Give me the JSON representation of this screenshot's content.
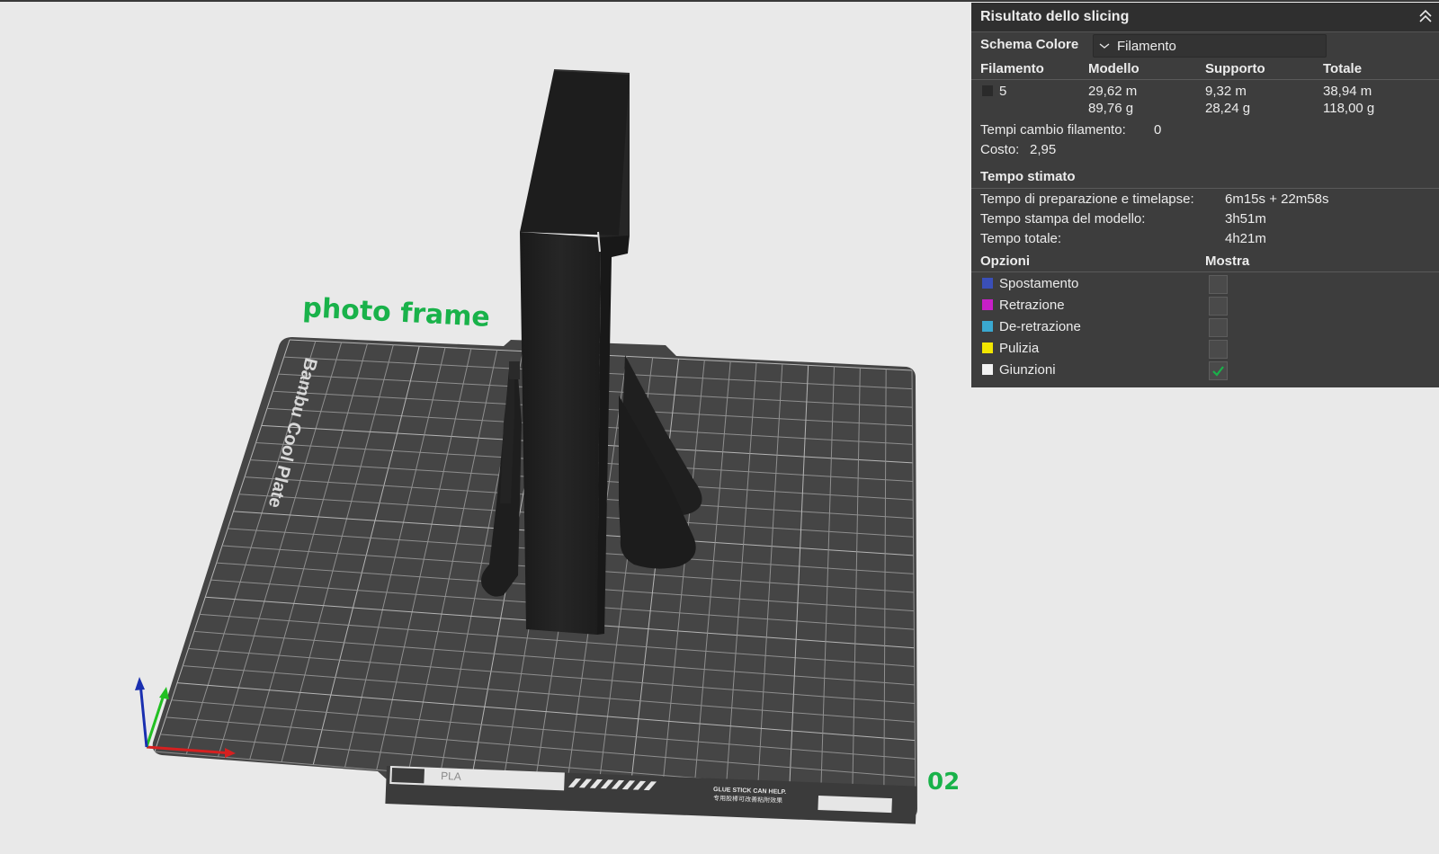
{
  "scene": {
    "plate_label": "Bambu Cool Plate",
    "object_label": "photo frame",
    "plate_number": "02",
    "plate_strip_text": "PLA",
    "plate_glue_text": "GLUE STICK CAN HELP.",
    "plate_glue_text_2": "专用胶棒可改善粘附效果",
    "colors": {
      "background": "#e9e9e9",
      "plate": "#454545",
      "grid": "#8f8f8f",
      "model": "#202020",
      "label_green": "#19b24a",
      "axis_x": "#d62020",
      "axis_y": "#22c022",
      "axis_z": "#1a2fb0"
    }
  },
  "panel": {
    "title": "Risultato dello slicing",
    "color_scheme_label": "Schema Colore",
    "color_scheme_value": "Filamento",
    "columns": [
      "Filamento",
      "Modello",
      "Supporto",
      "Totale"
    ],
    "filament": {
      "id": "5",
      "swatch_color": "#2a2a2a",
      "model_length": "29,62 m",
      "model_weight": "89,76 g",
      "support_length": "9,32 m",
      "support_weight": "28,24 g",
      "total_length": "38,94 m",
      "total_weight": "118,00 g"
    },
    "filament_changes_label": "Tempi cambio filamento:",
    "filament_changes_value": "0",
    "cost_label": "Costo:",
    "cost_value": "2,95",
    "estimated_time_title": "Tempo stimato",
    "prep_label": "Tempo di preparazione e timelapse:",
    "prep_value": "6m15s + 22m58s",
    "model_time_label": "Tempo stampa del modello:",
    "model_time_value": "3h51m",
    "total_time_label": "Tempo totale:",
    "total_time_value": "4h21m",
    "options_label": "Opzioni",
    "show_label": "Mostra",
    "options": [
      {
        "label": "Spostamento",
        "color": "#3a4fb8",
        "checked": false
      },
      {
        "label": "Retrazione",
        "color": "#c81fc8",
        "checked": false
      },
      {
        "label": "De-retrazione",
        "color": "#3aa8d0",
        "checked": false
      },
      {
        "label": "Pulizia",
        "color": "#f2e600",
        "checked": false
      },
      {
        "label": "Giunzioni",
        "color": "#f2f2f2",
        "checked": true
      }
    ]
  }
}
